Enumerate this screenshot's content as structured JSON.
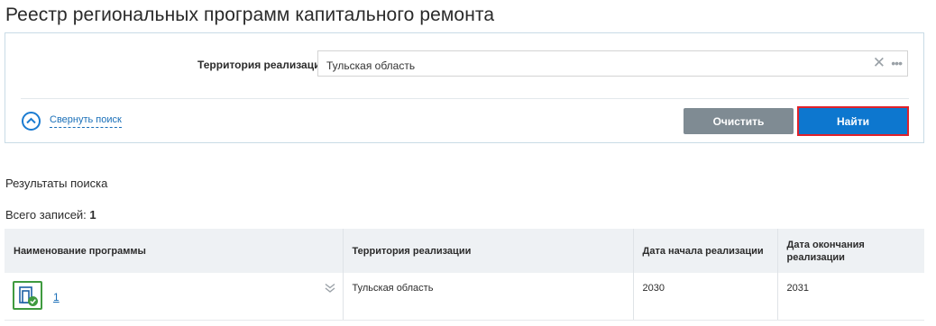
{
  "page": {
    "title": "Реестр региональных программ капитального ремонта"
  },
  "search": {
    "territory_label": "Территория реализации",
    "territory_value": "Тульская область",
    "clear_icon": "close-icon",
    "more_icon": "more-icon",
    "collapse_label": "Свернуть поиск",
    "collapse_icon": "chevron-up-circle-icon",
    "clear_button": "Очистить",
    "find_button": "Найти"
  },
  "results": {
    "title": "Результаты поиска",
    "total_label": "Всего записей:",
    "total_value": "1",
    "columns": [
      "Наименование программы",
      "Территория реализации",
      "Дата начала реализации",
      "Дата окончания реализации"
    ],
    "rows": [
      {
        "program_icon": "program-approved-icon",
        "name": "1",
        "territory": "Тульская область",
        "start": "2030",
        "end": "2031"
      }
    ]
  },
  "colors": {
    "accent": "#0d77cf",
    "clear_button": "#7f8b93",
    "highlight_border": "#e0222b",
    "approved": "#3f9a3f"
  }
}
